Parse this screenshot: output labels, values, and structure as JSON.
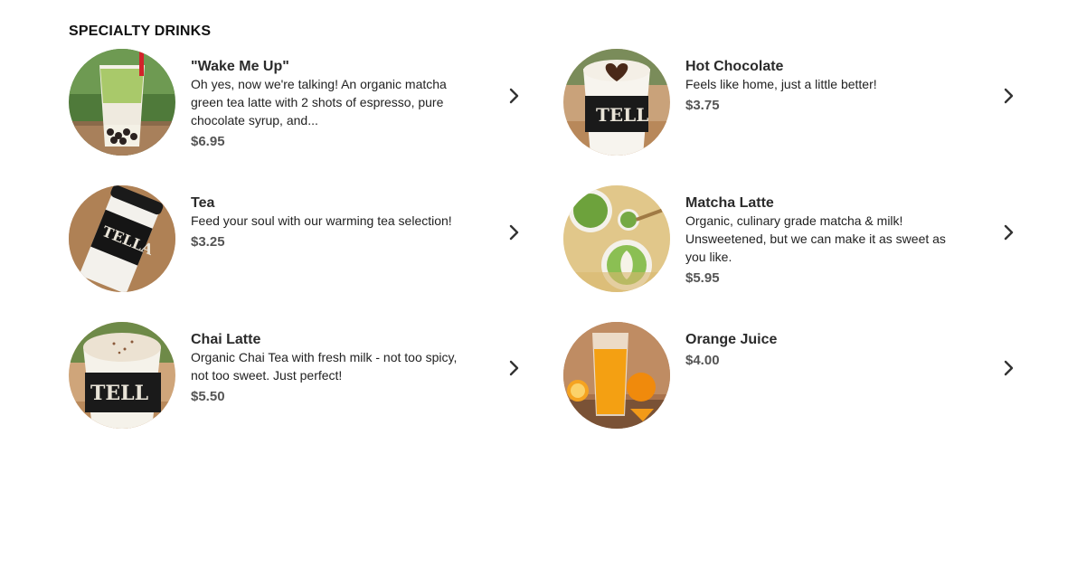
{
  "section": {
    "title": "SPECIALTY DRINKS"
  },
  "items": [
    {
      "name": "\"Wake Me Up\"",
      "description": "Oh yes, now we're talking! An organic matcha green tea latte with 2 shots of espresso, pure chocolate syrup, and...",
      "price": "$6.95",
      "image": "boba-matcha-latte-photo"
    },
    {
      "name": "Hot Chocolate",
      "description": "Feels like home, just a little better!",
      "price": "$3.75",
      "image": "hot-chocolate-photo"
    },
    {
      "name": "Tea",
      "description": "Feed your soul with our warming tea selection!",
      "price": "$3.25",
      "image": "tea-cup-photo"
    },
    {
      "name": "Matcha Latte",
      "description": "Organic, culinary grade matcha & milk! Unsweetened, but we can make it as sweet as you like.",
      "price": "$5.95",
      "image": "matcha-latte-photo"
    },
    {
      "name": "Chai Latte",
      "description": "Organic Chai Tea with fresh milk - not too spicy, not too sweet. Just perfect!",
      "price": "$5.50",
      "image": "chai-latte-photo"
    },
    {
      "name": "Orange Juice",
      "description": "",
      "price": "$4.00",
      "image": "orange-juice-photo"
    }
  ],
  "icons": {
    "chevron": "chevron-right-icon"
  }
}
